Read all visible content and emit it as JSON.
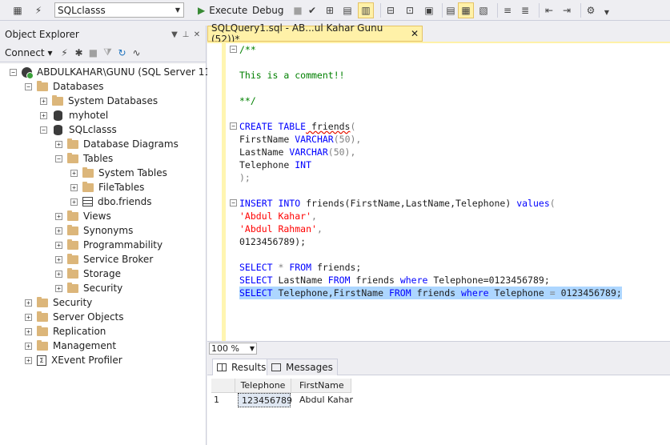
{
  "toolbar": {
    "database": "SQLclasss",
    "execute_label": "Execute",
    "debug_label": "Debug"
  },
  "object_explorer": {
    "title": "Object Explorer",
    "connect_label": "Connect",
    "tree": [
      {
        "label": "ABDULKAHAR\\GUNU (SQL Server 11.0.",
        "icon": "server-icon",
        "expander": "−"
      },
      {
        "label": "Databases",
        "icon": "folder-icon",
        "expander": "−"
      },
      {
        "label": "System Databases",
        "icon": "folder-icon",
        "expander": "+"
      },
      {
        "label": "myhotel",
        "icon": "database-icon",
        "expander": "+"
      },
      {
        "label": "SQLclasss",
        "icon": "database-icon",
        "expander": "−"
      },
      {
        "label": "Database Diagrams",
        "icon": "folder-icon",
        "expander": "+"
      },
      {
        "label": "Tables",
        "icon": "folder-icon",
        "expander": "−"
      },
      {
        "label": "System Tables",
        "icon": "folder-icon",
        "expander": "+"
      },
      {
        "label": "FileTables",
        "icon": "folder-icon",
        "expander": "+"
      },
      {
        "label": "dbo.friends",
        "icon": "table-icon",
        "expander": "+"
      },
      {
        "label": "Views",
        "icon": "folder-icon",
        "expander": "+"
      },
      {
        "label": "Synonyms",
        "icon": "folder-icon",
        "expander": "+"
      },
      {
        "label": "Programmability",
        "icon": "folder-icon",
        "expander": "+"
      },
      {
        "label": "Service Broker",
        "icon": "folder-icon",
        "expander": "+"
      },
      {
        "label": "Storage",
        "icon": "folder-icon",
        "expander": "+"
      },
      {
        "label": "Security",
        "icon": "folder-icon",
        "expander": "+"
      },
      {
        "label": "Security",
        "icon": "folder-icon",
        "expander": "+"
      },
      {
        "label": "Server Objects",
        "icon": "folder-icon",
        "expander": "+"
      },
      {
        "label": "Replication",
        "icon": "folder-icon",
        "expander": "+"
      },
      {
        "label": "Management",
        "icon": "folder-icon",
        "expander": "+"
      },
      {
        "label": "XEvent Profiler",
        "icon": "xevent-icon",
        "expander": "+"
      }
    ]
  },
  "editor": {
    "tab_label": "SQLQuery1.sql - AB...ul Kahar Gunu (52))*",
    "tab_close": "✕",
    "code": {
      "c1": "/**",
      "c2": "This is a comment!!",
      "c3": "**/",
      "create_kw": "CREATE TABLE",
      "create_name": " friends",
      "create_paren": "(",
      "col1_name": "FirstName ",
      "col1_type": "VARCHAR",
      "col1_rest": "(50),",
      "col2_name": "LastName ",
      "col2_type": "VARCHAR",
      "col2_rest": "(50),",
      "col3_name": "Telephone ",
      "col3_type": "INT",
      "close_paren": ");",
      "insert_kw": "INSERT INTO",
      "insert_rest": " friends(FirstName,LastName,Telephone) ",
      "values_kw": "values",
      "values_paren": "(",
      "v1": "'Abdul Kahar'",
      "v1c": ",",
      "v2": "'Abdul Rahman'",
      "v2c": ",",
      "v3": "0123456789);",
      "s1_kw": "SELECT",
      "s1_star": " * ",
      "s1_from": "FROM",
      "s1_rest": " friends;",
      "s2_kw": "SELECT",
      "s2_a": " LastName ",
      "s2_from": "FROM",
      "s2_b": " friends ",
      "s2_where": "where",
      "s2_c": " Telephone=0123456789;",
      "s3_kw": "SELECT",
      "s3_a": " Telephone,FirstName ",
      "s3_from": "FROM",
      "s3_b": " friends ",
      "s3_where": "where",
      "s3_c": " Telephone ",
      "s3_eq": "=",
      "s3_d": " 0123456789;"
    }
  },
  "zoom": "100 %",
  "results": {
    "tab_results": "Results",
    "tab_messages": "Messages",
    "columns": [
      "Telephone",
      "FirstName"
    ],
    "rows": [
      {
        "num": "1",
        "telephone": "123456789",
        "firstname": "Abdul Kahar"
      }
    ]
  }
}
